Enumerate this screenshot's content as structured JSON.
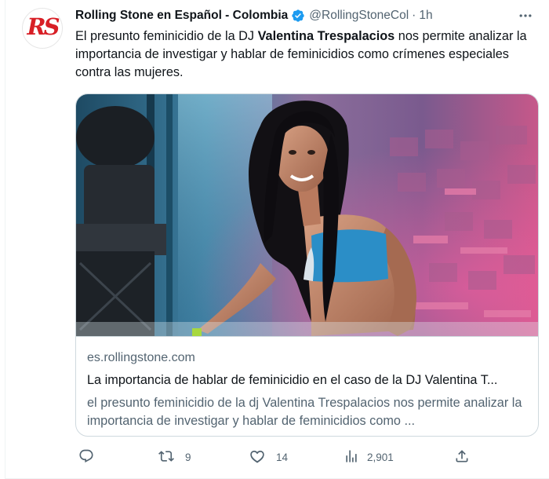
{
  "tweet": {
    "author_name": "Rolling Stone en Español - Colombia",
    "handle": "@RollingStoneCol",
    "separator": "·",
    "time": "1h",
    "avatar_text": "RS",
    "text_before": "El presunto feminicidio de la DJ ",
    "text_bold": "Valentina Trespalacios",
    "text_after": " nos permite analizar la importancia de investigar y hablar de feminicidios como crímenes especiales contra las mujeres."
  },
  "card": {
    "domain": "es.rollingstone.com",
    "title": "La importancia de hablar de feminicidio en el caso de la DJ Valentina T...",
    "description": "el presunto feminicidio de la dj Valentina Trespalacios nos permite analizar la importancia de investigar y hablar de feminicidios como ..."
  },
  "actions": {
    "reply_count": "",
    "retweet_count": "9",
    "like_count": "14",
    "views_count": "2,901"
  },
  "icons": {
    "verified": "verified-badge-icon",
    "more": "more-options-icon",
    "reply": "reply-icon",
    "retweet": "retweet-icon",
    "like": "heart-icon",
    "views": "views-chart-icon",
    "share": "share-icon"
  },
  "colors": {
    "verified": "#1d9bf0",
    "brand_red": "#d81f26",
    "muted": "#536471",
    "text": "#0f1419",
    "border": "#cfd9de"
  }
}
